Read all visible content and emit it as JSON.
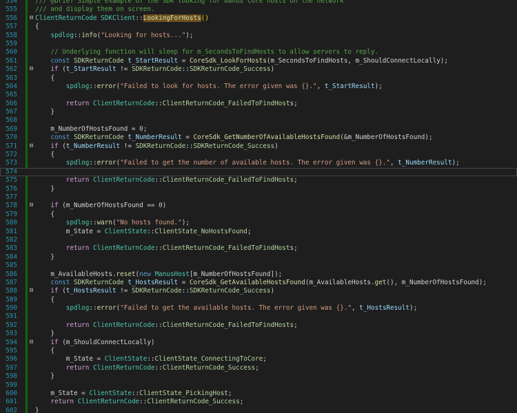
{
  "editor": {
    "lines": [
      {
        "n": "554",
        "tokens": [
          [
            "c",
            "/// @brief Simple example of the SDK looking for manus core hosts on the network"
          ]
        ]
      },
      {
        "n": "555",
        "tokens": [
          [
            "c",
            "/// and display them on screen."
          ]
        ]
      },
      {
        "n": "556",
        "fold": "⊟",
        "tokens": [
          [
            "t",
            "ClientReturnCode"
          ],
          [
            "p",
            " "
          ],
          [
            "t",
            "SDKClient"
          ],
          [
            "p",
            "::"
          ],
          [
            "hl",
            "LookingForHosts"
          ],
          [
            "lp",
            "()"
          ]
        ]
      },
      {
        "n": "557",
        "tokens": [
          [
            "p",
            "{"
          ]
        ]
      },
      {
        "n": "558",
        "tokens": [
          [
            "p",
            "    "
          ],
          [
            "t",
            "spdlog"
          ],
          [
            "p",
            "::"
          ],
          [
            "f",
            "info"
          ],
          [
            "p",
            "("
          ],
          [
            "s",
            "\"Looking for hosts...\""
          ],
          [
            "p",
            ");"
          ]
        ]
      },
      {
        "n": "559",
        "tokens": []
      },
      {
        "n": "560",
        "tokens": [
          [
            "p",
            "    "
          ],
          [
            "c",
            "// Underlying function will sleep for m_SecondsToFindHosts to allow servers to reply."
          ]
        ]
      },
      {
        "n": "561",
        "tokens": [
          [
            "p",
            "    "
          ],
          [
            "k",
            "const"
          ],
          [
            "p",
            " "
          ],
          [
            "e",
            "SDKReturnCode"
          ],
          [
            "p",
            " "
          ],
          [
            "v",
            "t_StartResult"
          ],
          [
            "p",
            " = "
          ],
          [
            "f",
            "CoreSdk_LookForHosts"
          ],
          [
            "p",
            "(m_SecondsToFindHosts, m_ShouldConnectLocally);"
          ]
        ]
      },
      {
        "n": "562",
        "fold": "⊟",
        "tokens": [
          [
            "p",
            "    "
          ],
          [
            "kc",
            "if"
          ],
          [
            "p",
            " ("
          ],
          [
            "v",
            "t_StartResult"
          ],
          [
            "p",
            " != "
          ],
          [
            "e",
            "SDKReturnCode"
          ],
          [
            "p",
            "::"
          ],
          [
            "e",
            "SDKReturnCode_Success"
          ],
          [
            "p",
            ")"
          ]
        ]
      },
      {
        "n": "563",
        "tokens": [
          [
            "p",
            "    {"
          ]
        ]
      },
      {
        "n": "564",
        "tokens": [
          [
            "p",
            "        "
          ],
          [
            "t",
            "spdlog"
          ],
          [
            "p",
            "::"
          ],
          [
            "f",
            "error"
          ],
          [
            "p",
            "("
          ],
          [
            "s",
            "\"Failed to look for hosts. The error given was {}.\""
          ],
          [
            "p",
            ", "
          ],
          [
            "v",
            "t_StartResult"
          ],
          [
            "p",
            ");"
          ]
        ]
      },
      {
        "n": "565",
        "tokens": []
      },
      {
        "n": "566",
        "tokens": [
          [
            "p",
            "        "
          ],
          [
            "kc",
            "return"
          ],
          [
            "p",
            " "
          ],
          [
            "t",
            "ClientReturnCode"
          ],
          [
            "p",
            "::"
          ],
          [
            "e",
            "ClientReturnCode_FailedToFindHosts"
          ],
          [
            "p",
            ";"
          ]
        ]
      },
      {
        "n": "567",
        "tokens": [
          [
            "p",
            "    }"
          ]
        ]
      },
      {
        "n": "568",
        "tokens": []
      },
      {
        "n": "569",
        "tokens": [
          [
            "p",
            "    m_NumberOfHostsFound = "
          ],
          [
            "n",
            "0"
          ],
          [
            "p",
            ";"
          ]
        ]
      },
      {
        "n": "570",
        "tokens": [
          [
            "p",
            "    "
          ],
          [
            "k",
            "const"
          ],
          [
            "p",
            " "
          ],
          [
            "e",
            "SDKReturnCode"
          ],
          [
            "p",
            " "
          ],
          [
            "v",
            "t_NumberResult"
          ],
          [
            "p",
            " = "
          ],
          [
            "f",
            "CoreSdk_GetNumberOfAvailableHostsFound"
          ],
          [
            "p",
            "(&m_NumberOfHostsFound);"
          ]
        ]
      },
      {
        "n": "571",
        "fold": "⊟",
        "tokens": [
          [
            "p",
            "    "
          ],
          [
            "kc",
            "if"
          ],
          [
            "p",
            " ("
          ],
          [
            "v",
            "t_NumberResult"
          ],
          [
            "p",
            " != "
          ],
          [
            "e",
            "SDKReturnCode"
          ],
          [
            "p",
            "::"
          ],
          [
            "e",
            "SDKReturnCode_Success"
          ],
          [
            "p",
            ")"
          ]
        ]
      },
      {
        "n": "572",
        "tokens": [
          [
            "p",
            "    {"
          ]
        ]
      },
      {
        "n": "573",
        "tokens": [
          [
            "p",
            "        "
          ],
          [
            "t",
            "spdlog"
          ],
          [
            "p",
            "::"
          ],
          [
            "f",
            "error"
          ],
          [
            "p",
            "("
          ],
          [
            "s",
            "\"Failed to get the number of available hosts. The error given was {}.\""
          ],
          [
            "p",
            ", "
          ],
          [
            "v",
            "t_NumberResult"
          ],
          [
            "p",
            ");"
          ]
        ]
      },
      {
        "n": "574",
        "current": true,
        "tokens": []
      },
      {
        "n": "575",
        "tokens": [
          [
            "p",
            "        "
          ],
          [
            "kc",
            "return"
          ],
          [
            "p",
            " "
          ],
          [
            "t",
            "ClientReturnCode"
          ],
          [
            "p",
            "::"
          ],
          [
            "e",
            "ClientReturnCode_FailedToFindHosts"
          ],
          [
            "p",
            ";"
          ]
        ]
      },
      {
        "n": "576",
        "tokens": [
          [
            "p",
            "    }"
          ]
        ]
      },
      {
        "n": "577",
        "tokens": []
      },
      {
        "n": "578",
        "fold": "⊟",
        "tokens": [
          [
            "p",
            "    "
          ],
          [
            "kc",
            "if"
          ],
          [
            "p",
            " (m_NumberOfHostsFound == "
          ],
          [
            "n",
            "0"
          ],
          [
            "p",
            ")"
          ]
        ]
      },
      {
        "n": "579",
        "tokens": [
          [
            "p",
            "    {"
          ]
        ]
      },
      {
        "n": "580",
        "tokens": [
          [
            "p",
            "        "
          ],
          [
            "t",
            "spdlog"
          ],
          [
            "p",
            "::"
          ],
          [
            "f",
            "warn"
          ],
          [
            "p",
            "("
          ],
          [
            "s",
            "\"No hosts found.\""
          ],
          [
            "p",
            ");"
          ]
        ]
      },
      {
        "n": "581",
        "tokens": [
          [
            "p",
            "        m_State = "
          ],
          [
            "t",
            "ClientState"
          ],
          [
            "p",
            "::"
          ],
          [
            "e",
            "ClientState_NoHostsFound"
          ],
          [
            "p",
            ";"
          ]
        ]
      },
      {
        "n": "582",
        "tokens": []
      },
      {
        "n": "583",
        "tokens": [
          [
            "p",
            "        "
          ],
          [
            "kc",
            "return"
          ],
          [
            "p",
            " "
          ],
          [
            "t",
            "ClientReturnCode"
          ],
          [
            "p",
            "::"
          ],
          [
            "e",
            "ClientReturnCode_FailedToFindHosts"
          ],
          [
            "p",
            ";"
          ]
        ]
      },
      {
        "n": "584",
        "tokens": [
          [
            "p",
            "    }"
          ]
        ]
      },
      {
        "n": "585",
        "tokens": []
      },
      {
        "n": "586",
        "tokens": [
          [
            "p",
            "    m_AvailableHosts."
          ],
          [
            "f",
            "reset"
          ],
          [
            "p",
            "("
          ],
          [
            "k",
            "new"
          ],
          [
            "p",
            " "
          ],
          [
            "t",
            "ManusHost"
          ],
          [
            "p",
            "[m_NumberOfHostsFound]);"
          ]
        ]
      },
      {
        "n": "587",
        "tokens": [
          [
            "p",
            "    "
          ],
          [
            "k",
            "const"
          ],
          [
            "p",
            " "
          ],
          [
            "e",
            "SDKReturnCode"
          ],
          [
            "p",
            " "
          ],
          [
            "v",
            "t_HostsResult"
          ],
          [
            "p",
            " = "
          ],
          [
            "f",
            "CoreSdk_GetAvailableHostsFound"
          ],
          [
            "p",
            "(m_AvailableHosts."
          ],
          [
            "f",
            "get"
          ],
          [
            "p",
            "(), m_NumberOfHostsFound);"
          ]
        ]
      },
      {
        "n": "588",
        "fold": "⊟",
        "tokens": [
          [
            "p",
            "    "
          ],
          [
            "kc",
            "if"
          ],
          [
            "p",
            " ("
          ],
          [
            "v",
            "t_HostsResult"
          ],
          [
            "p",
            " != "
          ],
          [
            "e",
            "SDKReturnCode"
          ],
          [
            "p",
            "::"
          ],
          [
            "e",
            "SDKReturnCode_Success"
          ],
          [
            "p",
            ")"
          ]
        ]
      },
      {
        "n": "589",
        "tokens": [
          [
            "p",
            "    {"
          ]
        ]
      },
      {
        "n": "590",
        "tokens": [
          [
            "p",
            "        "
          ],
          [
            "t",
            "spdlog"
          ],
          [
            "p",
            "::"
          ],
          [
            "f",
            "error"
          ],
          [
            "p",
            "("
          ],
          [
            "s",
            "\"Failed to get the available hosts. The error given was {}.\""
          ],
          [
            "p",
            ", "
          ],
          [
            "v",
            "t_HostsResult"
          ],
          [
            "p",
            ");"
          ]
        ]
      },
      {
        "n": "591",
        "tokens": []
      },
      {
        "n": "592",
        "tokens": [
          [
            "p",
            "        "
          ],
          [
            "kc",
            "return"
          ],
          [
            "p",
            " "
          ],
          [
            "t",
            "ClientReturnCode"
          ],
          [
            "p",
            "::"
          ],
          [
            "e",
            "ClientReturnCode_FailedToFindHosts"
          ],
          [
            "p",
            ";"
          ]
        ]
      },
      {
        "n": "593",
        "tokens": [
          [
            "p",
            "    }"
          ]
        ]
      },
      {
        "n": "594",
        "fold": "⊟",
        "tokens": [
          [
            "p",
            "    "
          ],
          [
            "kc",
            "if"
          ],
          [
            "p",
            " (m_ShouldConnectLocally)"
          ]
        ]
      },
      {
        "n": "595",
        "tokens": [
          [
            "p",
            "    {"
          ]
        ]
      },
      {
        "n": "596",
        "tokens": [
          [
            "p",
            "        m_State = "
          ],
          [
            "t",
            "ClientState"
          ],
          [
            "p",
            "::"
          ],
          [
            "e",
            "ClientState_ConnectingToCore"
          ],
          [
            "p",
            ";"
          ]
        ]
      },
      {
        "n": "597",
        "tokens": [
          [
            "p",
            "        "
          ],
          [
            "kc",
            "return"
          ],
          [
            "p",
            " "
          ],
          [
            "t",
            "ClientReturnCode"
          ],
          [
            "p",
            "::"
          ],
          [
            "e",
            "ClientReturnCode_Success"
          ],
          [
            "p",
            ";"
          ]
        ]
      },
      {
        "n": "598",
        "tokens": [
          [
            "p",
            "    }"
          ]
        ]
      },
      {
        "n": "599",
        "tokens": []
      },
      {
        "n": "600",
        "tokens": [
          [
            "p",
            "    m_State = "
          ],
          [
            "t",
            "ClientState"
          ],
          [
            "p",
            "::"
          ],
          [
            "e",
            "ClientState_PickingHost"
          ],
          [
            "p",
            ";"
          ]
        ]
      },
      {
        "n": "601",
        "tokens": [
          [
            "p",
            "    "
          ],
          [
            "kc",
            "return"
          ],
          [
            "p",
            " "
          ],
          [
            "t",
            "ClientReturnCode"
          ],
          [
            "p",
            "::"
          ],
          [
            "e",
            "ClientReturnCode_Success"
          ],
          [
            "p",
            ";"
          ]
        ]
      },
      {
        "n": "602",
        "tokens": [
          [
            "p",
            "}"
          ]
        ]
      }
    ]
  }
}
